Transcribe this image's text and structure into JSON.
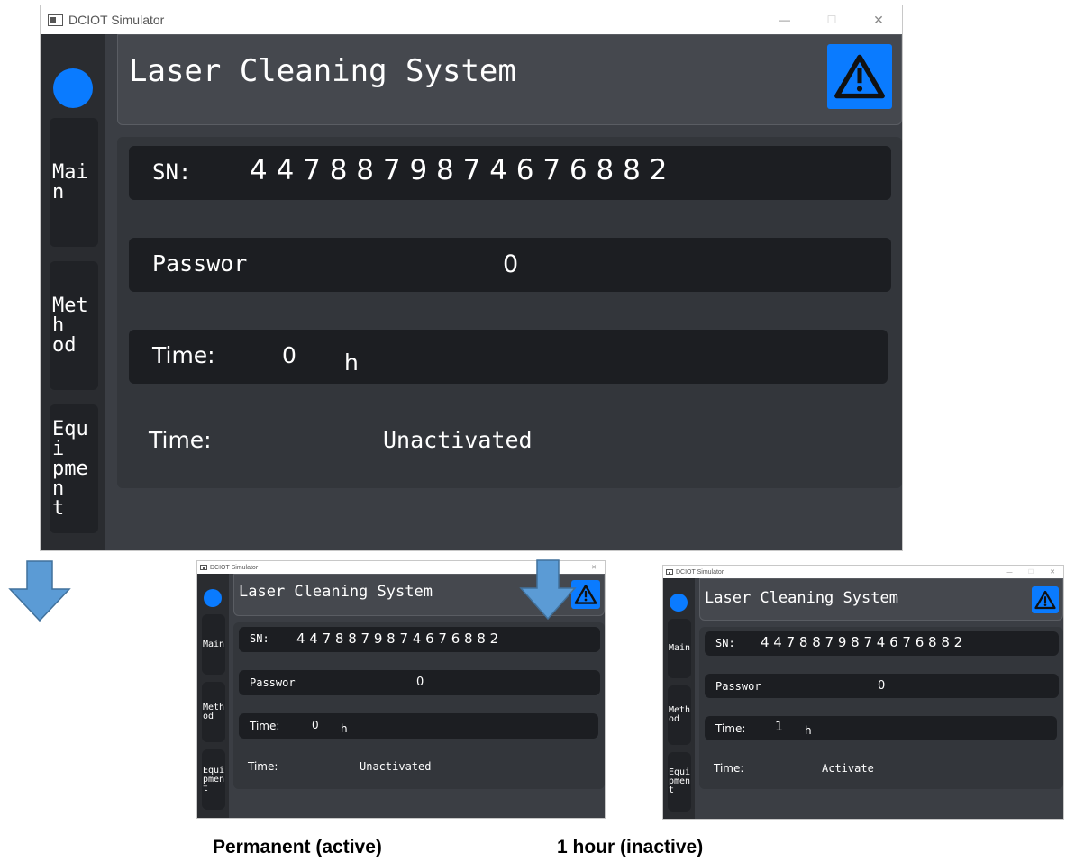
{
  "window": {
    "title": "DCIOT Simulator",
    "controls": {
      "minimize": "—",
      "maximize": "☐",
      "close": "✕"
    }
  },
  "nav": {
    "main": "Main",
    "method": "Meth\nod",
    "equipment": "Equi\npmen\nt"
  },
  "header": {
    "title": "Laser Cleaning System",
    "alarm_icon": "warning-triangle-icon"
  },
  "screens": [
    {
      "sn_label": "SN:",
      "sn_value": "4 4 7 8 8 7 9 8 7 4 6 7 6 8 8 2",
      "password_label": "Passwor",
      "password_value": "0",
      "time_label": "Time:",
      "time_value": "0",
      "time_unit": "h",
      "status_label": "Time:",
      "status_value": "Unactivated"
    },
    {
      "sn_label": "SN:",
      "sn_value": "4 4 7 8 8 7 9 8 7 4 6 7 6 8 8 2",
      "password_label": "Passwor",
      "password_value": "0",
      "time_label": "Time:",
      "time_value": "0",
      "time_unit": "h",
      "status_label": "Time:",
      "status_value": "Unactivated"
    },
    {
      "sn_label": "SN:",
      "sn_value": "4 4 7 8 8 7 9 8 7 4 6 7 6 8 8 2",
      "password_label": "Passwor",
      "password_value": "0",
      "time_label": "Time:",
      "time_value": "1",
      "time_unit": "h",
      "status_label": "Time:",
      "status_value": "Activate"
    }
  ],
  "captions": {
    "left": "Permanent (active)",
    "right": "1 hour (inactive)"
  },
  "colors": {
    "accent": "#0a7bff",
    "arrow": "#5b9bd5",
    "background": "#3b3e44",
    "row": "#1c1e22"
  }
}
